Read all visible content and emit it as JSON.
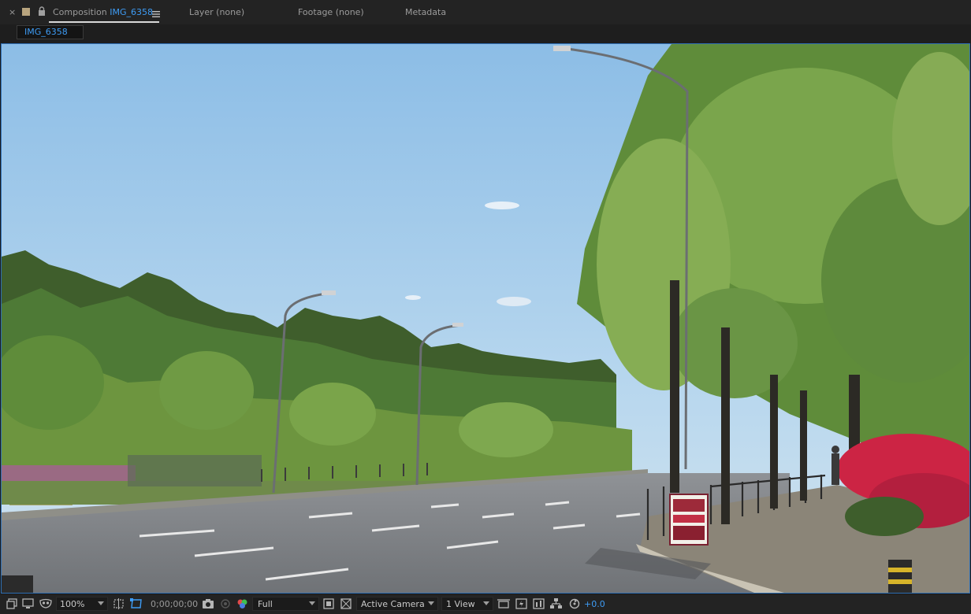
{
  "panel_tabs": {
    "composition_prefix": "Composition",
    "composition_name": "IMG_6358",
    "layer": "Layer (none)",
    "footage": "Footage (none)",
    "metadata": "Metadata"
  },
  "comp_subtab": "IMG_6358",
  "toolbar": {
    "zoom": "100%",
    "timecode": "0;00;00;00",
    "resolution": "Full",
    "camera": "Active Camera",
    "view_layout": "1 View",
    "exposure": "+0.0"
  },
  "colors": {
    "accent": "#3e9cf5",
    "panel_bg": "#232323",
    "viewer_border": "#2f6fb4"
  },
  "icons": [
    "close-icon",
    "lock-icon",
    "panel-menu-icon",
    "always-preview-icon",
    "monitor-icon",
    "mask-visibility-icon",
    "region-of-interest-icon",
    "transparency-grid-icon",
    "snapshot-icon",
    "show-snapshot-icon",
    "color-channels-icon",
    "fast-preview-icon",
    "toggle-transparency-icon",
    "3d-view-icon",
    "draft-3d-icon",
    "flowchart-icon",
    "reset-exposure-icon"
  ]
}
